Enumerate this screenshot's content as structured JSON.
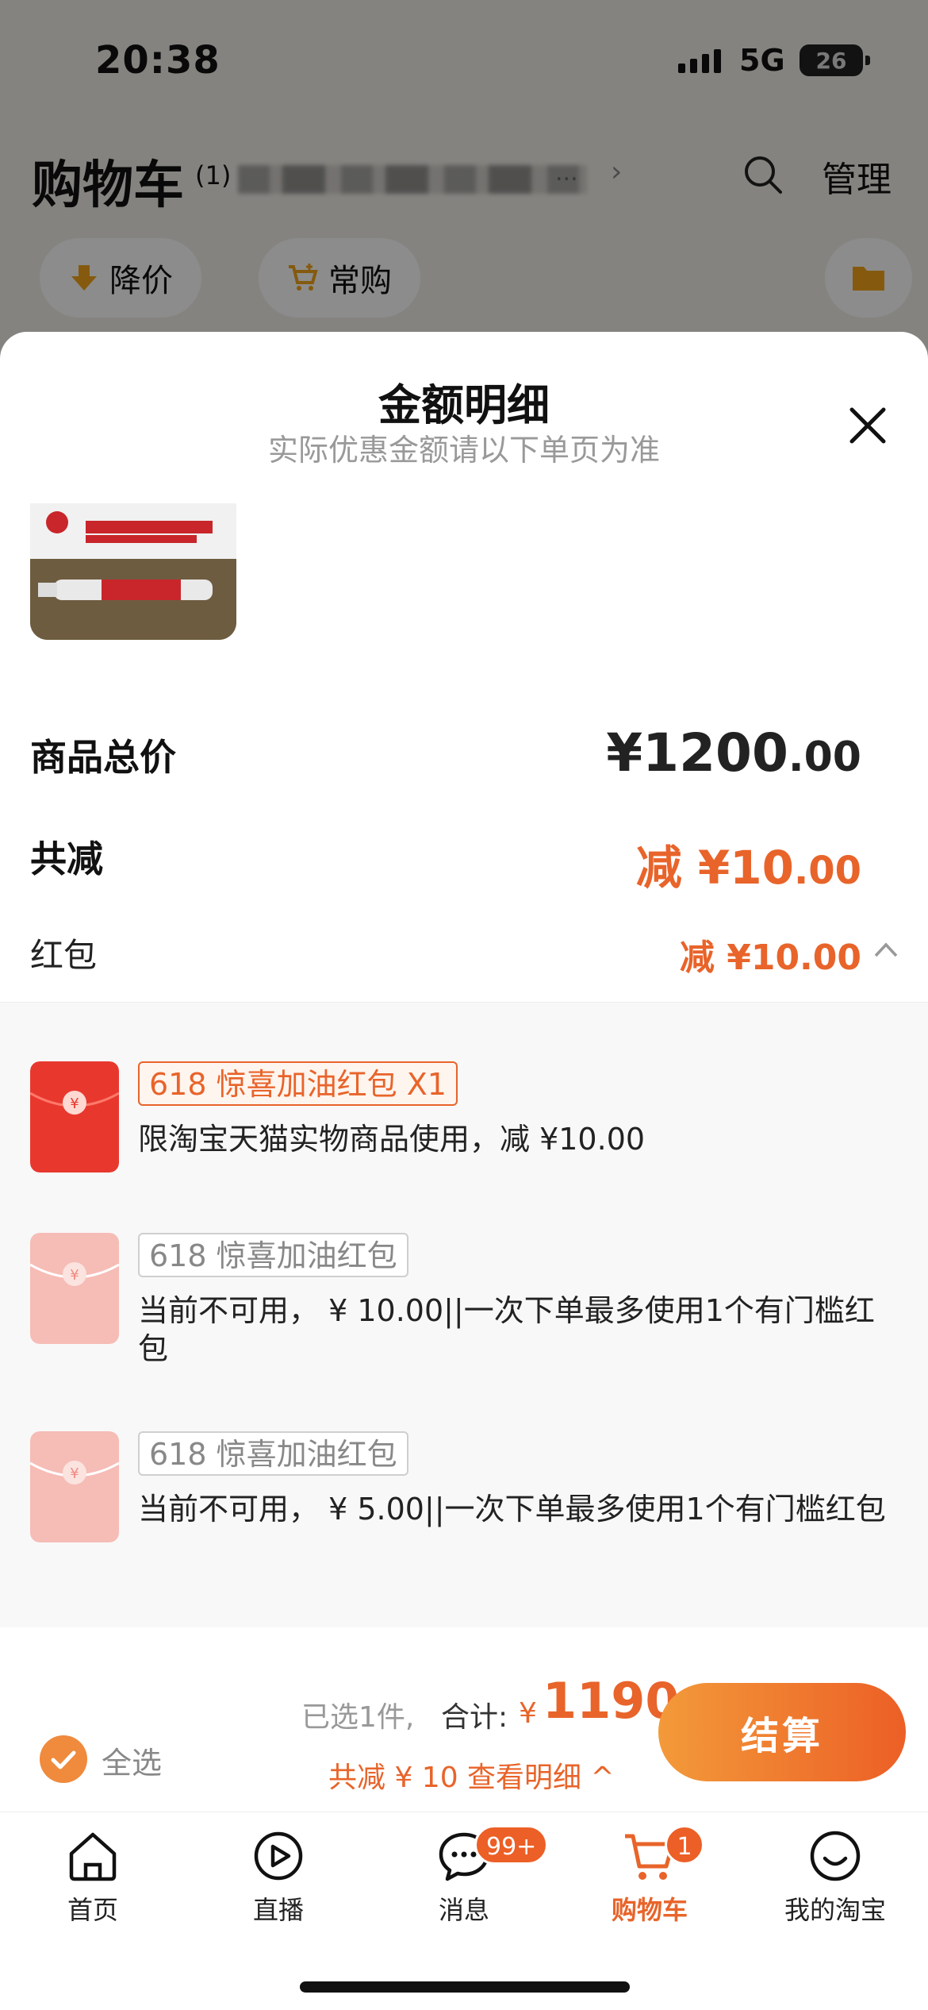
{
  "status_bar": {
    "time": "20:38",
    "network": "5G",
    "battery": "26"
  },
  "cart_header": {
    "title": "购物车",
    "count": "(1)",
    "address_ellipsis": "...",
    "chevron": "›",
    "manage": "管理"
  },
  "filters": [
    {
      "label": "降价",
      "icon": "price-drop-icon"
    },
    {
      "label": "常购",
      "icon": "cart-plus-icon"
    }
  ],
  "sheet": {
    "title": "金额明细",
    "subtitle": "实际优惠金额请以下单页为准",
    "total": {
      "label": "商品总价",
      "currency": "¥",
      "int": "1200",
      "cents": ".00"
    },
    "reduction": {
      "label": "共减",
      "prefix": "减 ¥",
      "int": "10",
      "cents": ".00"
    },
    "hongbao": {
      "label": "红包",
      "value": "减 ¥10.00"
    },
    "coupons": [
      {
        "tag": "618 惊喜加油红包 X1",
        "desc": "限淘宝天猫实物商品使用，减 ¥10.00",
        "active": true
      },
      {
        "tag": "618 惊喜加油红包",
        "desc": "当前不可用， ¥ 10.00||一次下单最多使用1个有门槛红包",
        "active": false
      },
      {
        "tag": "618 惊喜加油红包",
        "desc": "当前不可用， ¥ 5.00||一次下单最多使用1个有门槛红包",
        "active": false
      }
    ]
  },
  "checkout": {
    "select_all": "全选",
    "picked": "已选1件,",
    "sum_label": "合计:",
    "currency": "¥",
    "sum": "1190",
    "reduce_text": "共减 ¥ 10 查看明细 ^",
    "button": "结算"
  },
  "tabs": [
    {
      "label": "首页",
      "icon": "home-icon"
    },
    {
      "label": "直播",
      "icon": "live-icon"
    },
    {
      "label": "消息",
      "icon": "message-icon",
      "badge": "99+"
    },
    {
      "label": "购物车",
      "icon": "cart-icon",
      "badge": "1",
      "active": true
    },
    {
      "label": "我的淘宝",
      "icon": "profile-icon"
    }
  ],
  "colors": {
    "accent": "#e8642a",
    "checkout_gradient_start": "#f39a3a",
    "checkout_gradient_end": "#ec5f26"
  }
}
